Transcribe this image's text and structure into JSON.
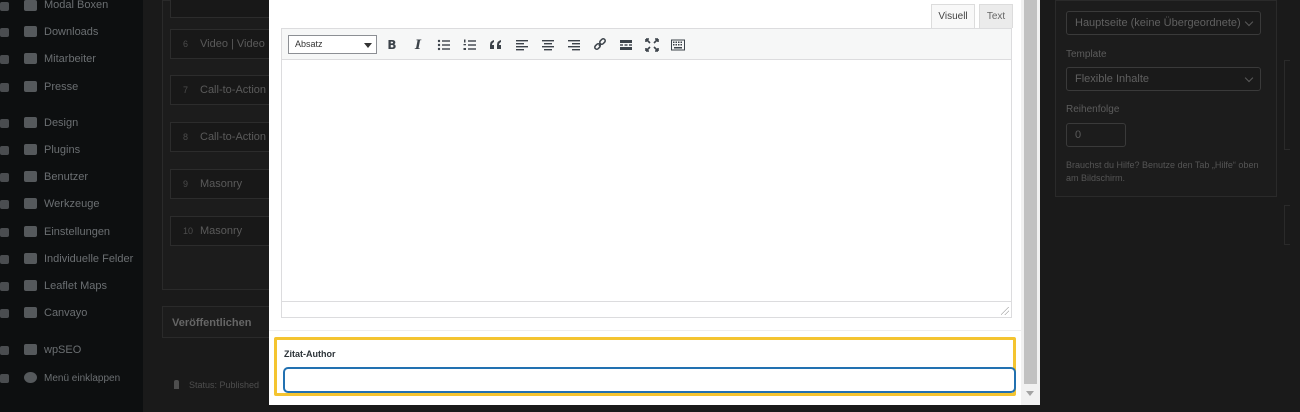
{
  "sidebar": {
    "items": [
      {
        "label": "Modal Boxen",
        "icon": "megaphone-icon"
      },
      {
        "label": "Downloads",
        "icon": "download-icon"
      },
      {
        "label": "Mitarbeiter",
        "icon": "users-icon"
      },
      {
        "label": "Presse",
        "icon": "document-icon"
      },
      {
        "label": "Design",
        "icon": "paintbrush-icon"
      },
      {
        "label": "Plugins",
        "icon": "plugin-icon"
      },
      {
        "label": "Benutzer",
        "icon": "user-icon"
      },
      {
        "label": "Werkzeuge",
        "icon": "wrench-icon"
      },
      {
        "label": "Einstellungen",
        "icon": "settings-icon"
      },
      {
        "label": "Individuelle Felder",
        "icon": "fields-icon"
      },
      {
        "label": "Leaflet Maps",
        "icon": "map-icon"
      },
      {
        "label": "Canvayo",
        "icon": "gear-icon"
      },
      {
        "label": "wpSEO",
        "icon": "seo-icon"
      },
      {
        "label": "Menü einklappen",
        "icon": "collapse-icon"
      }
    ]
  },
  "layout_rows": [
    {
      "num": "6",
      "label": "Video | Video"
    },
    {
      "num": "7",
      "label": "Call-to-Action"
    },
    {
      "num": "8",
      "label": "Call-to-Action"
    },
    {
      "num": "9",
      "label": "Masonry"
    },
    {
      "num": "10",
      "label": "Masonry"
    }
  ],
  "publish": {
    "heading": "Veröffentlichen",
    "status": "Status: Published"
  },
  "page_attributes": {
    "parent_value": "Hauptseite (keine Übergeordnete)",
    "template_label": "Template",
    "template_value": "Flexible Inhalte",
    "order_label": "Reihenfolge",
    "order_value": "0",
    "help_text": "Brauchst du Hilfe? Benutze den Tab „Hilfe“ oben am Bildschirm."
  },
  "editor": {
    "tab_visual": "Visuell",
    "tab_text": "Text",
    "format_select": "Absatz",
    "toolbar_icons": [
      "bold-icon",
      "italic-icon",
      "bullet-list-icon",
      "numbered-list-icon",
      "blockquote-icon",
      "align-left-icon",
      "align-center-icon",
      "align-right-icon",
      "link-icon",
      "read-more-icon",
      "fullscreen-icon",
      "toolbar-toggle-icon"
    ]
  },
  "field": {
    "label": "Zitat-Author",
    "value": ""
  },
  "colors": {
    "highlight": "#f4c430",
    "focus": "#2271b1"
  }
}
